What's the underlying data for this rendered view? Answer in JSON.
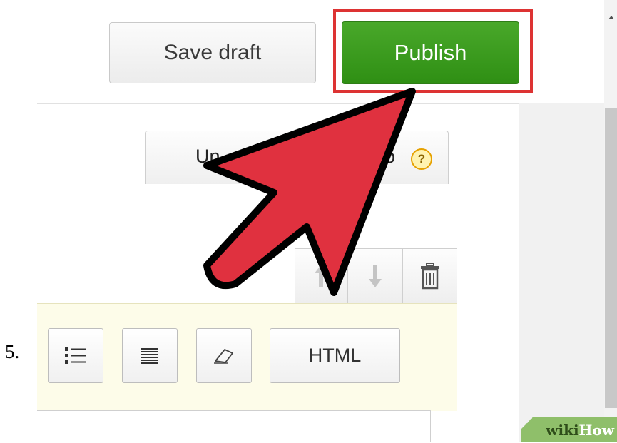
{
  "header": {
    "save_draft_label": "Save draft",
    "publish_label": "Publish"
  },
  "panel": {
    "partial_button_label_left": "Un",
    "partial_button_label_right": "o",
    "help_symbol": "?"
  },
  "post_controls": {
    "move_up_icon": "arrow-up-icon",
    "move_down_icon": "arrow-down-icon",
    "delete_icon": "trash-icon"
  },
  "toolbar": {
    "list_icon": "bulleted-list-icon",
    "justify_icon": "justify-align-icon",
    "eraser_icon": "eraser-icon",
    "html_label": "HTML"
  },
  "annotations": {
    "step_number": "5.",
    "arrow_color": "#e0313f",
    "highlight_color": "#dd3333"
  },
  "watermark": {
    "part1": "wiki",
    "part2": "How"
  },
  "colors": {
    "publish_green": "#3a9b1e",
    "toolbar_bg": "#fdfce9"
  }
}
